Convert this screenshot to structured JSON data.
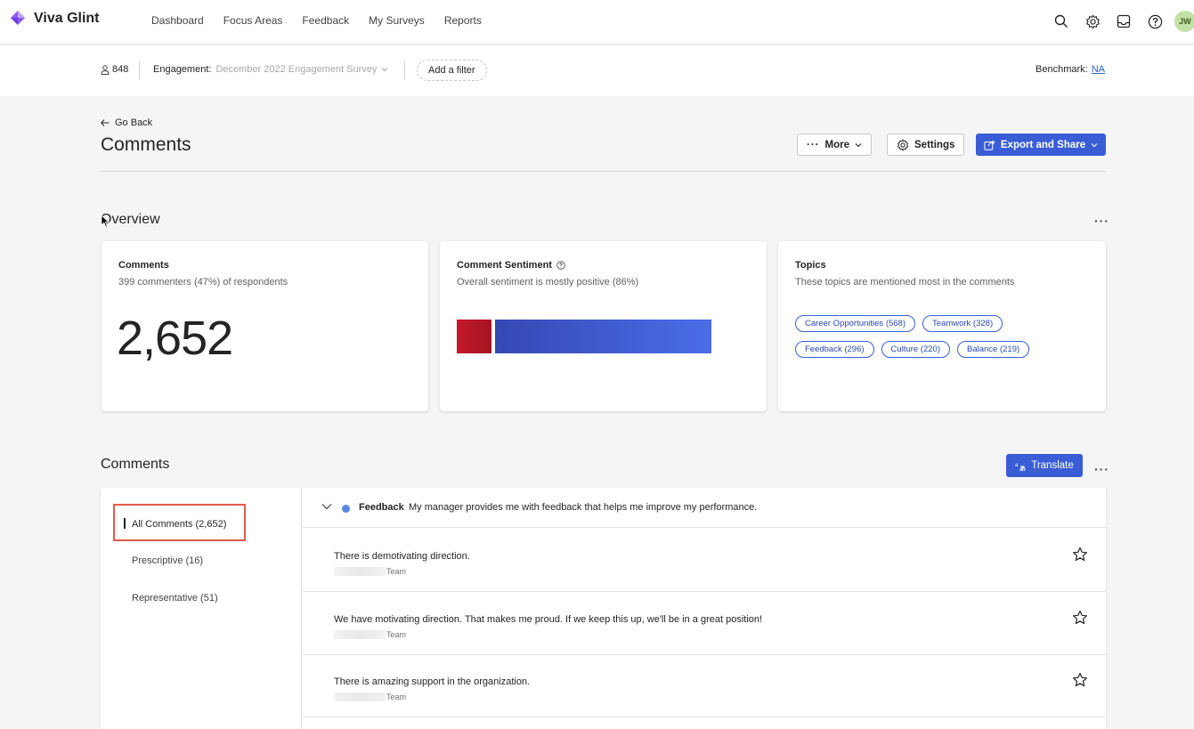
{
  "app": {
    "name": "Viva Glint"
  },
  "nav": {
    "links": [
      "Dashboard",
      "Focus Areas",
      "Feedback",
      "My Surveys",
      "Reports"
    ],
    "avatar_initials": "JW"
  },
  "filters": {
    "respondent_count": "848",
    "engagement_label": "Engagement:",
    "engagement_value": "December 2022 Engagement Survey",
    "add_filter": "Add a filter",
    "benchmark_label": "Benchmark:",
    "benchmark_value": "NA"
  },
  "page": {
    "go_back": "Go Back",
    "title": "Comments",
    "more_label": "More",
    "settings_label": "Settings",
    "export_label": "Export and Share"
  },
  "overview": {
    "title": "Overview",
    "comments_card": {
      "title": "Comments",
      "subtitle": "399 commenters (47%) of respondents",
      "total": "2,652"
    },
    "sentiment_card": {
      "title": "Comment Sentiment",
      "subtitle": "Overall sentiment is mostly positive (86%)",
      "negative_fraction": 0.14,
      "positive_fraction": 0.86,
      "negative_color": "#b81724",
      "positive_color": "#3f5ad4"
    },
    "topics_card": {
      "title": "Topics",
      "subtitle": "These topics are mentioned most in the comments",
      "topics": [
        "Career Opportunities (568)",
        "Teamwork (328)",
        "Feedback (296)",
        "Culture (220)",
        "Balance (219)"
      ]
    }
  },
  "comments": {
    "title": "Comments",
    "translate_label": "Translate",
    "sidebar": {
      "all": "All Comments (2,652)",
      "prescriptive": "Prescriptive (16)",
      "representative": "Representative (51)"
    },
    "question": {
      "category": "Feedback",
      "text": "My manager provides me with feedback that helps me improve my performance."
    },
    "items": [
      {
        "text": "There is demotivating direction.",
        "meta": "Team"
      },
      {
        "text": "We have motivating direction. That makes me proud. If we keep this up, we'll be in a great position!",
        "meta": "Team"
      },
      {
        "text": "There is amazing support in the organization.",
        "meta": "Team"
      }
    ]
  }
}
